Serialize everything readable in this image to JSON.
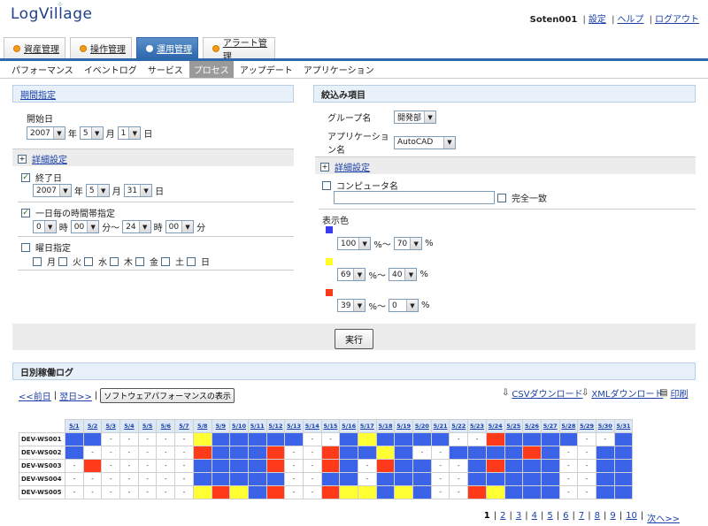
{
  "header": {
    "logo": "LogVillage",
    "user": "Soten001",
    "links": [
      "設定",
      "ヘルプ",
      "ログアウト"
    ]
  },
  "tabs": [
    {
      "label": "資産管理",
      "active": false
    },
    {
      "label": "操作管理",
      "active": false
    },
    {
      "label": "運用管理",
      "active": true
    },
    {
      "label": "アラート管理",
      "active": false
    }
  ],
  "subnav": [
    {
      "label": "パフォーマンス",
      "active": false
    },
    {
      "label": "イベントログ",
      "active": false
    },
    {
      "label": "サービス",
      "active": false
    },
    {
      "label": "プロセス",
      "active": true
    },
    {
      "label": "アップデート",
      "active": false
    },
    {
      "label": "アプリケーション",
      "active": false
    }
  ],
  "period": {
    "title": "期間指定",
    "start_label": "開始日",
    "start": {
      "year": "2007",
      "month": "5",
      "day": "1"
    },
    "units": {
      "year": "年",
      "month": "月",
      "day": "日",
      "hour": "時",
      "minute": "分",
      "minute_to": "分〜"
    },
    "detail_label": "詳細設定",
    "end_label": "終了日",
    "end": {
      "year": "2007",
      "month": "5",
      "day": "31"
    },
    "time_label": "一日毎の時間帯指定",
    "time": {
      "h1": "0",
      "m1": "00",
      "h2": "24",
      "m2": "00"
    },
    "weekday_label": "曜日指定",
    "weekdays": [
      "月",
      "火",
      "水",
      "木",
      "金",
      "土",
      "日"
    ]
  },
  "filter": {
    "title": "絞込み項目",
    "group_label": "グループ名",
    "group_value": "開発部",
    "app_label": "アプリケーション名",
    "app_value": "AutoCAD",
    "detail_label": "詳細設定",
    "computer_label": "コンピュータ名",
    "computer_value": "",
    "exact_label": "完全一致",
    "color_label": "表示色",
    "ranges": [
      {
        "color": "#3a3aee",
        "from": "100",
        "to": "70",
        "sep": "%〜",
        "unit": "%"
      },
      {
        "color": "#ffff22",
        "from": "69",
        "to": "40",
        "sep": "%〜",
        "unit": "%"
      },
      {
        "color": "#ff3a1a",
        "from": "39",
        "to": "0",
        "sep": "%〜",
        "unit": "%"
      }
    ]
  },
  "run_button": "実行",
  "daily": {
    "title": "日別稼働ログ",
    "prev": "<<前日",
    "next": "翌日>>",
    "perf_button": "ソフトウェアパフォーマンスの表示",
    "csv": "CSVダウンロード",
    "xml": "XMLダウンロード",
    "print": "印刷",
    "dates": [
      "5/1",
      "5/2",
      "5/3",
      "5/4",
      "5/5",
      "5/6",
      "5/7",
      "5/8",
      "5/9",
      "5/10",
      "5/11",
      "5/12",
      "5/13",
      "5/14",
      "5/15",
      "5/16",
      "5/17",
      "5/18",
      "5/19",
      "5/20",
      "5/21",
      "5/22",
      "5/23",
      "5/24",
      "5/25",
      "5/26",
      "5/27",
      "5/28",
      "5/29",
      "5/30",
      "5/31"
    ],
    "rows": [
      {
        "name": "DEV-WS001",
        "cells": "bb-----ybbbbb--bybbbb--rbbbb--bybb"
      },
      {
        "name": "DEV-WS002",
        "cells": "b------rbbbr--rbbyb--bbbbrb--bbbbr"
      },
      {
        "name": "DEV-WS003",
        "cells": "-r-----bbbbr--rb-rbb--brbbb--bbbbb"
      },
      {
        "name": "DEV-WS004",
        "cells": "-------bbbbb--bb-bbb--bbbbb--bbbbb"
      },
      {
        "name": "DEV-WS005",
        "cells": "-------yrybr--ryybyb--rybbb--bbbbb"
      }
    ]
  },
  "pager": {
    "pages": [
      "1",
      "2",
      "3",
      "4",
      "5",
      "6",
      "7",
      "8",
      "9",
      "10"
    ],
    "current": "1",
    "next": "次へ>>"
  }
}
